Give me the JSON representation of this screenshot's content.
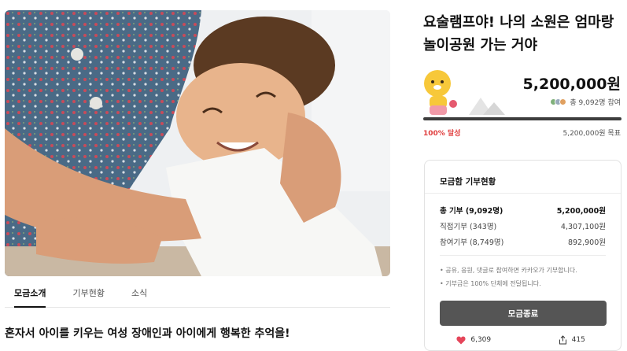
{
  "campaign": {
    "title": "요술램프야! 나의 소원은 엄마랑 놀이공원 가는 거야",
    "amount": "5,200,000원",
    "participants": "총 9,092명 참여",
    "progress": 1.0,
    "progress_label": "100% 달성",
    "goal": "5,200,000원 목표"
  },
  "tabs": [
    {
      "label": "모금소개"
    },
    {
      "label": "기부현황"
    },
    {
      "label": "소식"
    }
  ],
  "story": {
    "headline": "혼자서 아이를 키우는 여성 장애인과 아이에게 행복한 추억을!"
  },
  "donation_box": {
    "title": "모금함 기부현황",
    "rows": [
      {
        "label": "총 기부 (9,092명)",
        "value": "5,200,000원"
      },
      {
        "label": "직접기부 (343명)",
        "value": "4,307,100원"
      },
      {
        "label": "참여기부 (8,749명)",
        "value": "892,900원"
      }
    ],
    "notes": [
      "• 공유, 응원, 댓글로 참여하면 카카오가 기부합니다.",
      "• 기부금은 100% 단체에 전달됩니다."
    ],
    "button_label": "모금종료",
    "likes": "6,309",
    "shares": "415"
  },
  "colors": {
    "accent_red": "#e03e3e",
    "button_gray": "#555555",
    "progress_fill": "#3d3d3d"
  },
  "icons": {
    "like": "heart-icon",
    "share": "share-icon"
  }
}
